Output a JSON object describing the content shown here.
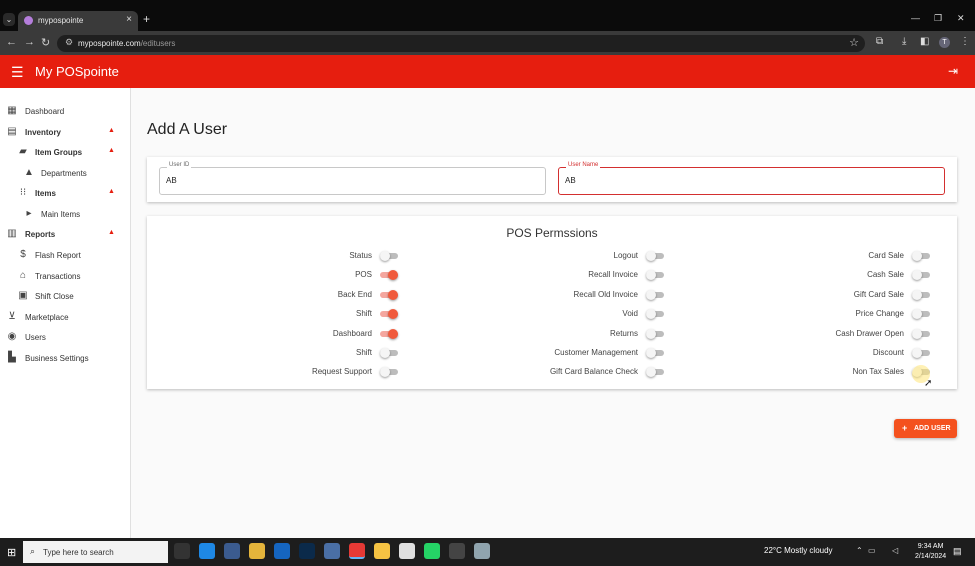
{
  "browser": {
    "tab_title": "mypospointe",
    "new_tab": "+",
    "url_host": "mypospointe.com",
    "url_path": "/editusers",
    "profile_initial": "T"
  },
  "app": {
    "title": "My POSpointe",
    "accent_color": "#e61e0f"
  },
  "sidebar": {
    "items": [
      {
        "label": "Dashboard",
        "icon": "dashboard-icon"
      },
      {
        "label": "Inventory",
        "icon": "inventory-icon"
      },
      {
        "label": "Item Groups",
        "icon": "folder-icon"
      },
      {
        "label": "Departments",
        "icon": "shapes-icon"
      },
      {
        "label": "Items",
        "icon": "grid-icon"
      },
      {
        "label": "Main Items",
        "icon": "arrow-right-icon"
      },
      {
        "label": "Reports",
        "icon": "report-icon"
      },
      {
        "label": "Flash Report",
        "icon": "dollar-icon"
      },
      {
        "label": "Transactions",
        "icon": "bank-icon"
      },
      {
        "label": "Shift Close",
        "icon": "document-icon"
      },
      {
        "label": "Marketplace",
        "icon": "cart-icon"
      },
      {
        "label": "Users",
        "icon": "user-icon"
      },
      {
        "label": "Business Settings",
        "icon": "building-icon"
      }
    ]
  },
  "page": {
    "title": "Add A User",
    "user_id_label": "User ID",
    "user_id_value": "AB",
    "user_name_label": "User Name",
    "user_name_value": "AB"
  },
  "permissions": {
    "title": "POS Permssions",
    "col1": [
      {
        "label": "Status",
        "on": false
      },
      {
        "label": "POS",
        "on": true
      },
      {
        "label": "Back End",
        "on": true
      },
      {
        "label": "Shift",
        "on": true
      },
      {
        "label": "Dashboard",
        "on": true
      },
      {
        "label": "Shift",
        "on": false
      },
      {
        "label": "Request Support",
        "on": false
      }
    ],
    "col2": [
      {
        "label": "Logout",
        "on": false
      },
      {
        "label": "Recall Invoice",
        "on": false
      },
      {
        "label": "Recall Old Invoice",
        "on": false
      },
      {
        "label": "Void",
        "on": false
      },
      {
        "label": "Returns",
        "on": false
      },
      {
        "label": "Customer Management",
        "on": false
      },
      {
        "label": "Gift Card Balance Check",
        "on": false
      }
    ],
    "col3": [
      {
        "label": "Card Sale",
        "on": false
      },
      {
        "label": "Cash Sale",
        "on": false
      },
      {
        "label": "Gift Card Sale",
        "on": false
      },
      {
        "label": "Price Change",
        "on": false
      },
      {
        "label": "Cash Drawer Open",
        "on": false
      },
      {
        "label": "Discount",
        "on": false
      },
      {
        "label": "Non Tax Sales",
        "on": false
      }
    ]
  },
  "actions": {
    "add_user_label": "ADD USER"
  },
  "taskbar": {
    "search_placeholder": "Type here to search",
    "weather": "22°C  Mostly cloudy",
    "time": "9:34 AM",
    "date": "2/14/2024"
  }
}
